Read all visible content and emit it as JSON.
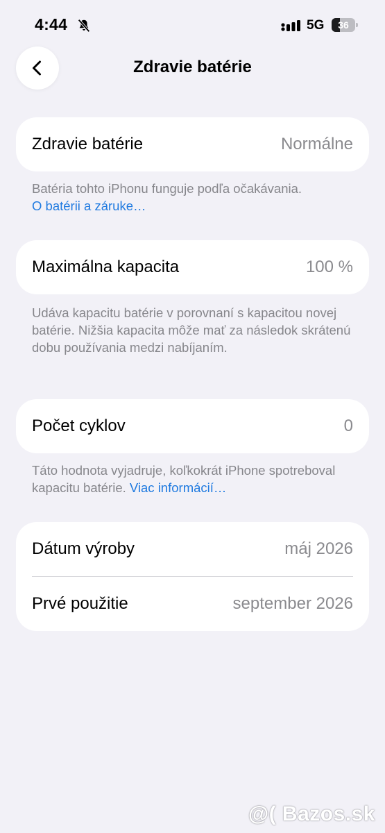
{
  "status_bar": {
    "time": "4:44",
    "network": "5G",
    "battery_level": "36",
    "battery_fraction": 0.36,
    "icons": [
      "bell-slash-icon",
      "cellular-signal-icon",
      "battery-icon"
    ]
  },
  "nav": {
    "back_icon": "chevron-left-icon",
    "title": "Zdravie batérie"
  },
  "sections": {
    "health": {
      "label": "Zdravie batérie",
      "value": "Normálne",
      "footnote_text": "Batéria tohto iPhonu funguje podľa očakávania.",
      "footnote_link": "O batérii a záruke…"
    },
    "capacity": {
      "label": "Maximálna kapacita",
      "value": "100 %",
      "footnote_text": "Udáva kapacitu batérie v porovnaní s kapacitou novej batérie. Nižšia kapacita môže mať za následok skrátenú dobu používania medzi nabíjaním."
    },
    "cycles": {
      "label": "Počet cyklov",
      "value": "0",
      "footnote_text": "Táto hodnota vyjadruje, koľkokrát iPhone spotreboval kapacitu batérie.",
      "footnote_link": "Viac informácií…"
    },
    "dates": {
      "manufacture_label": "Dátum výroby",
      "manufacture_value": "máj 2026",
      "first_use_label": "Prvé použitie",
      "first_use_value": "september 2026"
    }
  },
  "watermark": "@( Bazos.sk",
  "colors": {
    "background": "#F2F1F7",
    "card": "#FFFFFF",
    "secondary_text": "#8A8A8E",
    "link": "#1F7AE0"
  }
}
